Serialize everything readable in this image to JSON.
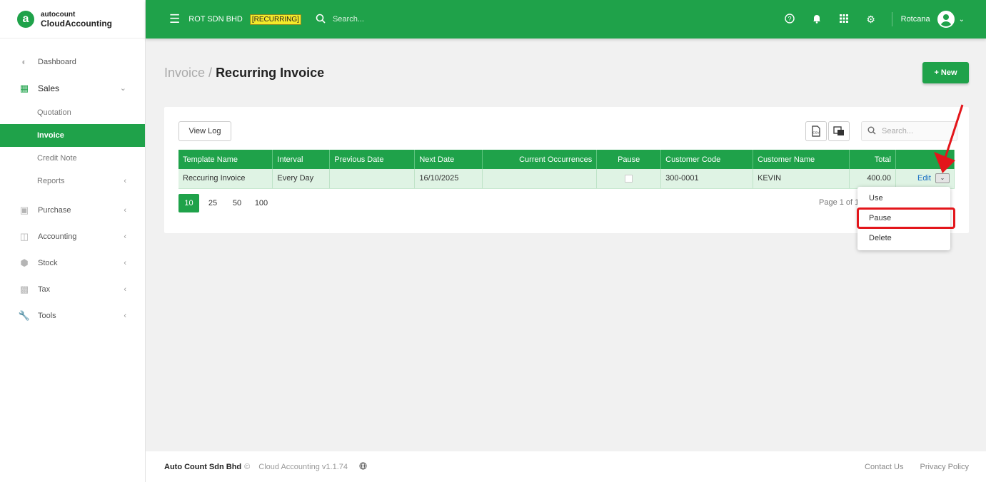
{
  "app": {
    "logo_letter": "a",
    "logo_top": "autocount",
    "logo_bottom": "CloudAccounting"
  },
  "sidebar": {
    "items": [
      {
        "label": "Dashboard",
        "icon": "dashboard-icon"
      },
      {
        "label": "Sales",
        "icon": "sales-icon",
        "expanded": true
      },
      {
        "label": "Purchase",
        "icon": "purchase-icon"
      },
      {
        "label": "Accounting",
        "icon": "accounting-icon"
      },
      {
        "label": "Stock",
        "icon": "stock-icon"
      },
      {
        "label": "Tax",
        "icon": "tax-icon"
      },
      {
        "label": "Tools",
        "icon": "tools-icon"
      }
    ],
    "sales_sub": [
      {
        "label": "Quotation"
      },
      {
        "label": "Invoice",
        "active": true
      },
      {
        "label": "Credit Note"
      },
      {
        "label": "Reports"
      }
    ]
  },
  "topbar": {
    "company": "ROT SDN BHD",
    "tag": "[RECURRING]",
    "search_placeholder": "Search...",
    "username": "Rotcana"
  },
  "page": {
    "breadcrumb_parent": "Invoice /",
    "title": "Recurring Invoice",
    "new_button": "+ New"
  },
  "toolbar": {
    "view_log": "View Log",
    "search_placeholder": "Search..."
  },
  "table": {
    "columns": [
      "Template Name",
      "Interval",
      "Previous Date",
      "Next Date",
      "Current Occurrences",
      "Pause",
      "Customer Code",
      "Customer Name",
      "Total",
      ""
    ],
    "rows": [
      {
        "template_name": "Reccuring Invoice",
        "interval": "Every Day",
        "previous_date": "",
        "next_date": "16/10/2025",
        "current_occurrences": "",
        "pause": false,
        "customer_code": "300-0001",
        "customer_name": "KEVIN",
        "total": "400.00",
        "action": "Edit"
      }
    ]
  },
  "pager": {
    "sizes": [
      "10",
      "25",
      "50",
      "100"
    ],
    "selected": "10",
    "info": "Page 1 of 1"
  },
  "dropdown": {
    "items": [
      "Use",
      "Pause",
      "Delete"
    ],
    "highlighted": "Pause"
  },
  "footer": {
    "company": "Auto Count Sdn Bhd",
    "copy": "©",
    "version": "Cloud Accounting v1.1.74",
    "contact": "Contact Us",
    "privacy": "Privacy Policy"
  },
  "colors": {
    "brand": "#1fa24a",
    "row_highlight": "#dff3e4",
    "annotation": "#e3161b",
    "tag_bg": "#f4ea2a"
  }
}
